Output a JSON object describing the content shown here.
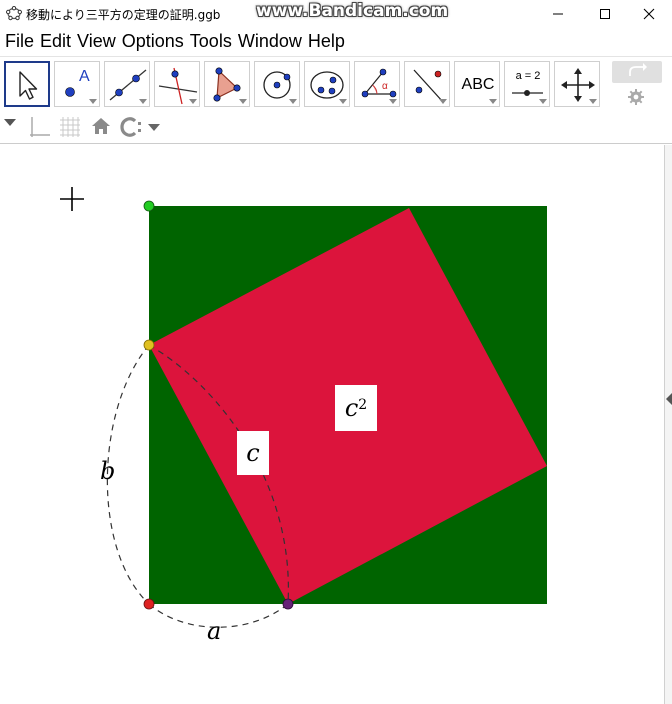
{
  "window": {
    "title": "移動により三平方の定理の証明.ggb",
    "watermark": "www.Bandicam.com"
  },
  "menu": [
    "File",
    "Edit",
    "View",
    "Options",
    "Tools",
    "Window",
    "Help"
  ],
  "toolbar": {
    "tools": [
      {
        "name": "move-tool-button",
        "icon": "move-arrow-icon",
        "selected": true
      },
      {
        "name": "point-tool-button",
        "icon": "point-icon",
        "label": "A"
      },
      {
        "name": "line-tool-button",
        "icon": "line-through-points-icon"
      },
      {
        "name": "perpendicular-line-tool-button",
        "icon": "perpendicular-line-icon"
      },
      {
        "name": "polygon-tool-button",
        "icon": "polygon-icon"
      },
      {
        "name": "circle-tool-button",
        "icon": "circle-center-point-icon"
      },
      {
        "name": "ellipse-tool-button",
        "icon": "ellipse-icon"
      },
      {
        "name": "angle-tool-button",
        "icon": "angle-icon",
        "label": "α"
      },
      {
        "name": "reflect-tool-button",
        "icon": "reflect-icon"
      },
      {
        "name": "text-tool-button",
        "icon": "text-icon",
        "label": "ABC"
      },
      {
        "name": "slider-tool-button",
        "icon": "slider-icon",
        "label": "a = 2"
      },
      {
        "name": "move-view-tool-button",
        "icon": "move-graphics-view-icon"
      }
    ]
  },
  "stylebar": {
    "icons": [
      "stylebar-toggle-icon",
      "axes-icon",
      "grid-icon",
      "home-icon",
      "point-capturing-icon"
    ]
  },
  "canvas": {
    "labels": {
      "a": "a",
      "b": "b",
      "c": "c",
      "c_squared_base": "c",
      "c_squared_exp": "2"
    },
    "colors": {
      "outer_square": "#006400",
      "inner_square": "#dc143c",
      "point_top": "#22cc22",
      "point_left": "#e0c020",
      "point_bottom_left": "#dd2222",
      "point_bottom": "#662277"
    }
  }
}
